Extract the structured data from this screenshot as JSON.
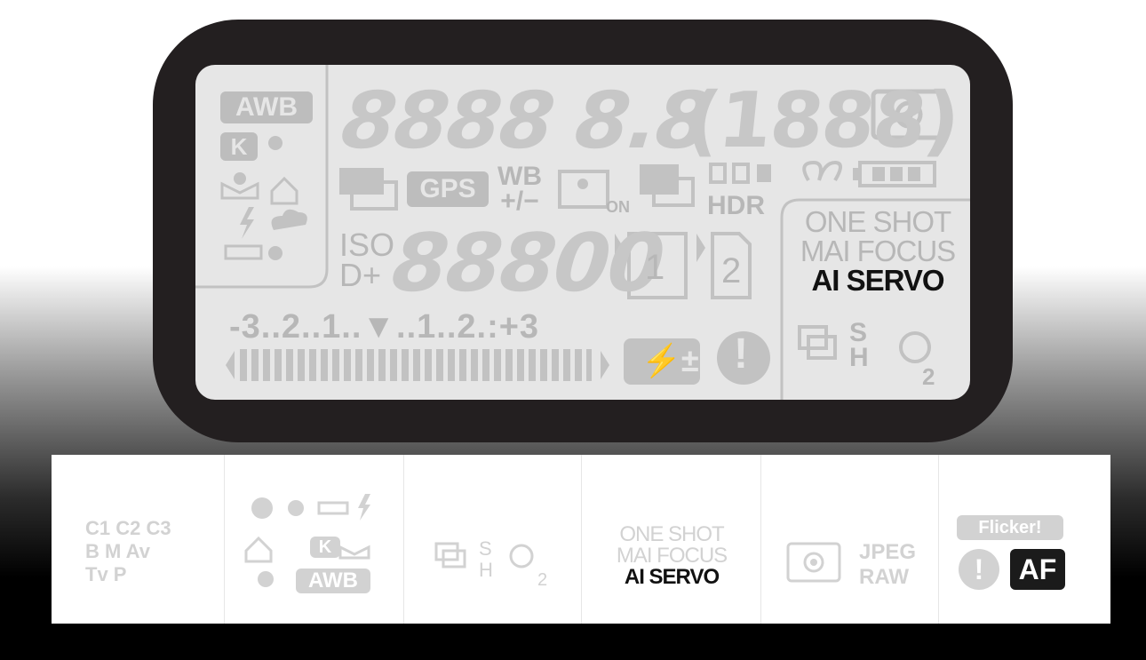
{
  "lcd": {
    "wb_modes": [
      "AWB",
      "K"
    ],
    "shutter_digits": "8888",
    "aperture_digits": "8.8",
    "shots_digits": "(1888)",
    "gps": "GPS",
    "wb_shift": {
      "line1": "WB",
      "line2": "+/−"
    },
    "on_label": "ON",
    "hdr": "HDR",
    "iso": {
      "line1": "ISO",
      "line2": "D+"
    },
    "iso_digits": "88800",
    "card1": "1",
    "card2": "2",
    "af_modes": [
      "ONE SHOT",
      "MAI FOCUS",
      "AI SERVO"
    ],
    "af_active": "AI SERVO",
    "exposure_scale": "-3..2..1..▼..1..2.:+3",
    "drive": {
      "s": "S",
      "h": "H",
      "timer": "2"
    },
    "warning": "!"
  },
  "panel": {
    "modes": {
      "row1": [
        "C1",
        "C2",
        "C3"
      ],
      "row2": "B M Av",
      "row3": "Tv P"
    },
    "wb": {
      "awb": "AWB",
      "k": "K"
    },
    "drive": {
      "s": "S",
      "h": "H",
      "timer": "2"
    },
    "af_modes": [
      "ONE SHOT",
      "MAI FOCUS",
      "AI SERVO"
    ],
    "quality": {
      "line1": "JPEG",
      "line2": "RAW"
    },
    "flicker": "Flicker!",
    "warning": "!",
    "af": "AF"
  }
}
